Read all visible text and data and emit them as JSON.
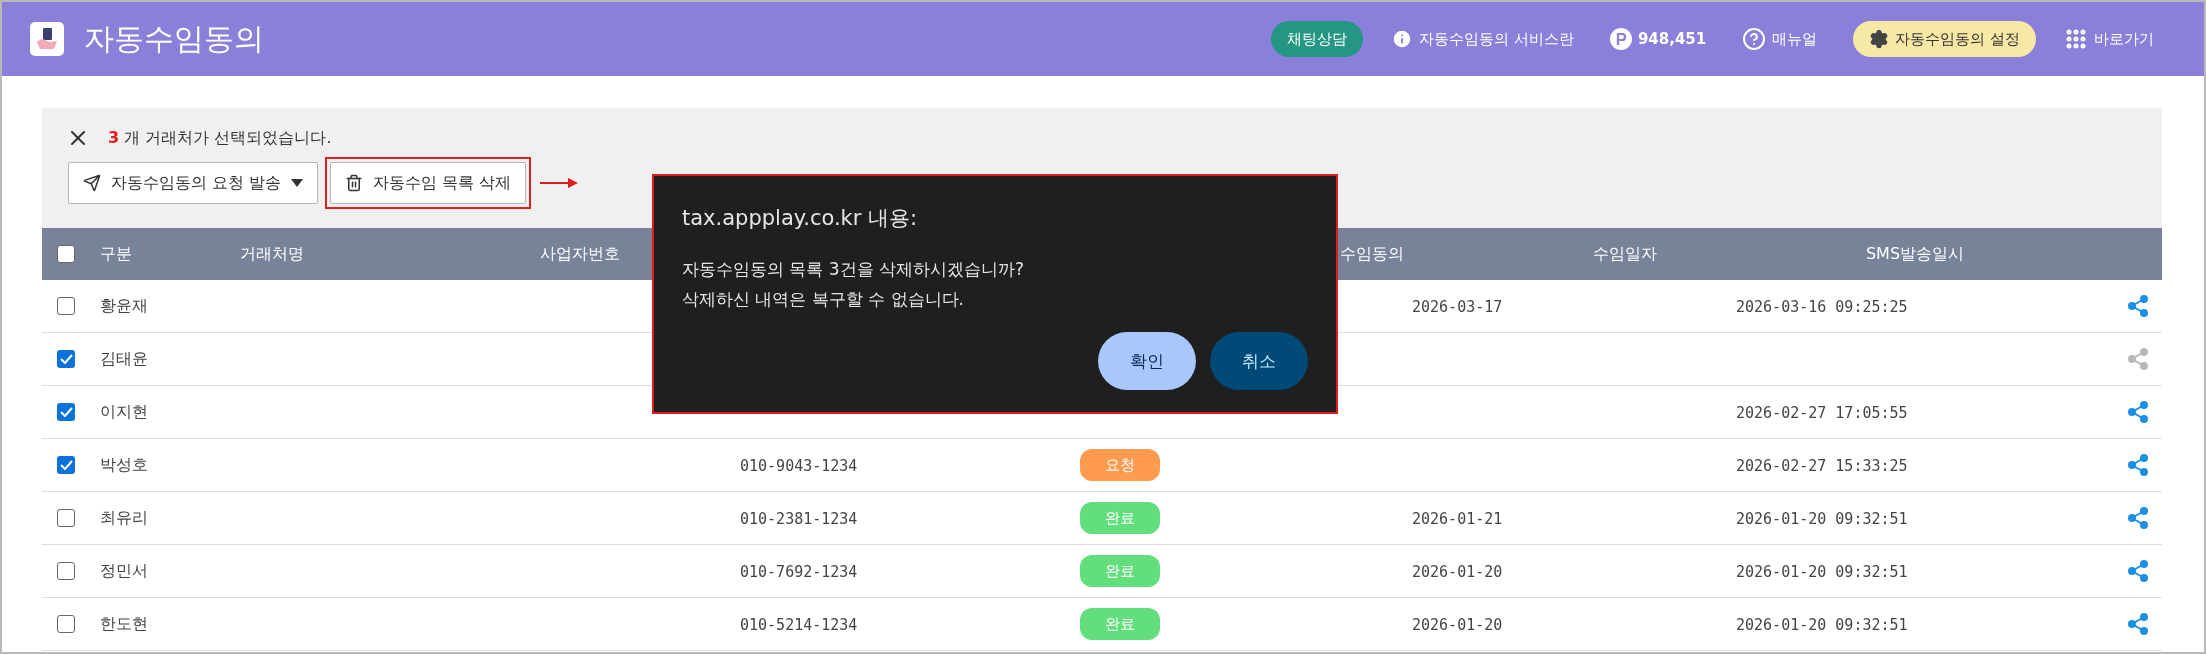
{
  "header": {
    "title": "자동수임동의",
    "chat_button": "채팅상담",
    "service_link": "자동수임동의 서비스란",
    "points": "948,451",
    "manual_link": "매뉴얼",
    "settings_button": "자동수임동의 설정",
    "shortcut_link": "바로가기"
  },
  "selection": {
    "count": "3",
    "text": "개 거래처가 선택되었습니다."
  },
  "actions": [
    {
      "kind": "send",
      "label": "자동수임동의 요청 발송",
      "highlighted": false
    },
    {
      "kind": "delete",
      "label": "자동수임 목록 삭제",
      "highlighted": true
    }
  ],
  "table": {
    "all_checked": false,
    "columns": [
      "구분",
      "거래처명",
      "사업자번호",
      "수임동의",
      "수임일자",
      "SMS발송일시"
    ],
    "rows": [
      {
        "name": "황윤재",
        "checked": false,
        "date": "2026-03-17",
        "sms": "2026-03-16 09:25:25",
        "share_enabled": true
      },
      {
        "name": "김태윤",
        "checked": true,
        "share_enabled": false
      },
      {
        "name": "이지현",
        "checked": true,
        "sms": "2026-02-27 17:05:55",
        "share_enabled": true
      },
      {
        "name": "박성호",
        "checked": true,
        "phone": "010-9043-1234",
        "status": {
          "label": "요청",
          "color": "#ff9b4f"
        },
        "sms": "2026-02-27 15:33:25",
        "share_enabled": true
      },
      {
        "name": "최유리",
        "checked": false,
        "phone": "010-2381-1234",
        "status": {
          "label": "완료",
          "color": "#62de7d"
        },
        "date": "2026-01-21",
        "sms": "2026-01-20 09:32:51",
        "share_enabled": true
      },
      {
        "name": "정민서",
        "checked": false,
        "phone": "010-7692-1234",
        "status": {
          "label": "완료",
          "color": "#62de7d"
        },
        "date": "2026-01-20",
        "sms": "2026-01-20 09:32:51",
        "share_enabled": true
      },
      {
        "name": "한도현",
        "checked": false,
        "phone": "010-5214-1234",
        "status": {
          "label": "완료",
          "color": "#62de7d"
        },
        "date": "2026-01-20",
        "sms": "2026-01-20 09:32:51",
        "share_enabled": true
      }
    ]
  },
  "dialog": {
    "title": "tax.appplay.co.kr 내용:",
    "lines": [
      "자동수임동의 목록 3건을 삭제하시겠습니까?",
      "삭제하신 내역은 복구할 수 없습니다."
    ],
    "buttons": [
      {
        "label": "확인",
        "primary": true
      },
      {
        "label": "취소",
        "primary": false
      }
    ]
  }
}
